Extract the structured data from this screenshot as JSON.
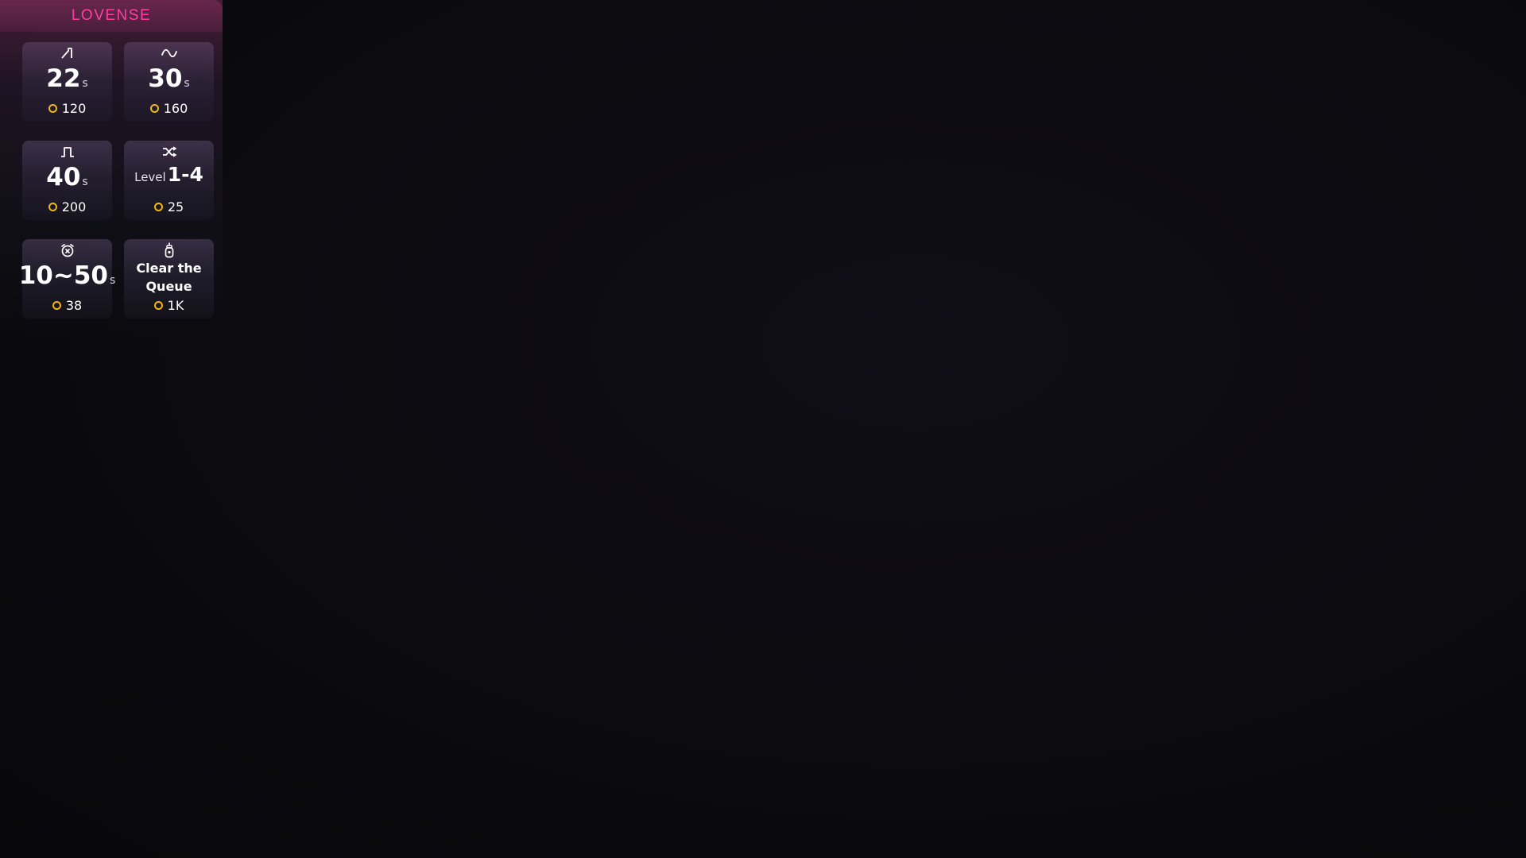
{
  "brand": "LOVENSE",
  "colors": {
    "brand": "#ff3fa0",
    "coin": "#f1b80e",
    "text": "#ffffff",
    "background": "#0b0a10"
  },
  "tiles": [
    {
      "icon": "pulse-step-icon",
      "value": "22",
      "unit": "s",
      "price": "120"
    },
    {
      "icon": "wave-icon",
      "value": "30",
      "unit": "s",
      "price": "160"
    },
    {
      "icon": "square-pulse-icon",
      "value": "40",
      "unit": "s",
      "price": "200"
    },
    {
      "icon": "shuffle-icon",
      "prefix": "Level",
      "value": "1-4",
      "price": "25"
    },
    {
      "icon": "alarm-clock-icon",
      "value": "10~50",
      "unit": "s",
      "price": "38"
    },
    {
      "icon": "bomb-icon",
      "line1": "Clear the",
      "line2": "Queue",
      "price": "1K"
    }
  ]
}
